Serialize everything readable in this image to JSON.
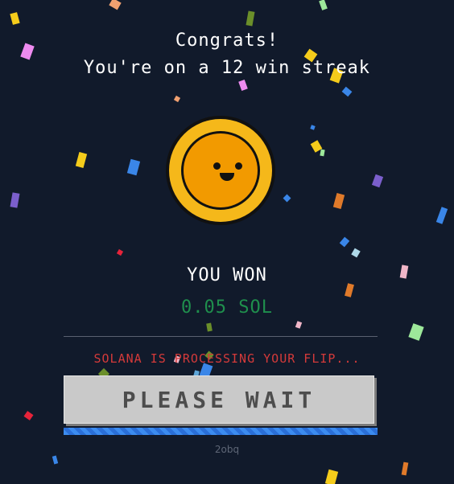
{
  "header": {
    "line1": "Congrats!",
    "line2": "You're on a 12 win streak"
  },
  "coin": {
    "icon": "smiley-coin-icon"
  },
  "result": {
    "label": "YOU WON",
    "amount": "0.05 SOL"
  },
  "status": {
    "text": "SOLANA IS PROCESSING YOUR FLIP..."
  },
  "action": {
    "button_label": "PLEASE WAIT"
  },
  "footer": {
    "text": "2obq"
  },
  "colors": {
    "background": "#111a2b",
    "amount": "#1f8f4d",
    "status": "#d43a3a",
    "coin_outer": "#f5b81a",
    "coin_inner": "#f29a00",
    "progress": "#3c8cf0"
  },
  "confetti_colors": [
    "#f5cc1b",
    "#ee8bf0",
    "#f0a070",
    "#6b8f2a",
    "#3a86e8",
    "#7b5fcc",
    "#e07a2a",
    "#9de89a",
    "#f0b6c8",
    "#e6233a",
    "#5ea6d8",
    "#aed8e8"
  ]
}
